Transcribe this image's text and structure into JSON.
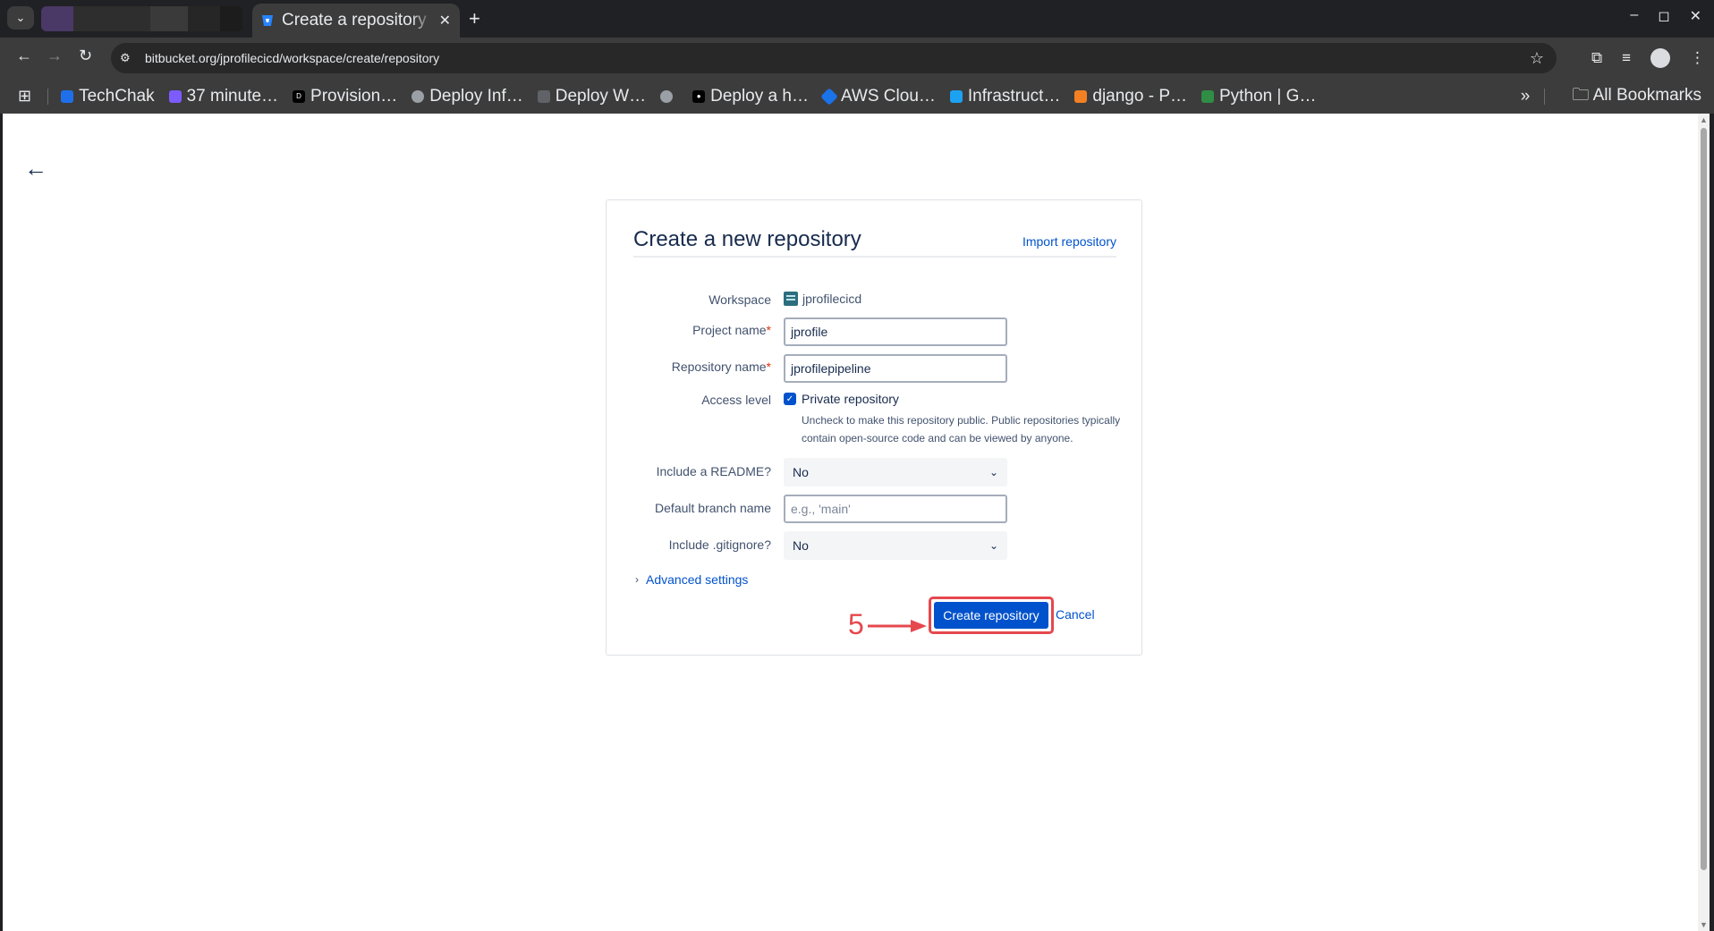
{
  "browser": {
    "tab_title": "Create a repository",
    "tab_close": "✕",
    "new_tab": "+",
    "url": "bitbucket.org/jprofilecicd/workspace/create/repository",
    "bookmarks": [
      {
        "label": "TechChak",
        "icon": "techchak-icon",
        "color": "#1f6feb"
      },
      {
        "label": "37 minute…",
        "icon": "dollar-icon",
        "color": "#7c5cff"
      },
      {
        "label": "Provision…",
        "icon": "dev-icon",
        "color": "#000000"
      },
      {
        "label": "Deploy Inf…",
        "icon": "globe-icon",
        "color": "#9aa0a6"
      },
      {
        "label": "Deploy W…",
        "icon": "mortarboard-icon",
        "color": "#202124"
      },
      {
        "label": "",
        "icon": "globe-icon",
        "color": "#9aa0a6"
      },
      {
        "label": "Deploy a h…",
        "icon": "medium-icon",
        "color": "#000000"
      },
      {
        "label": "AWS Clou…",
        "icon": "aws-icon",
        "color": "#1a73e8"
      },
      {
        "label": "Infrastruct…",
        "icon": "chart-icon",
        "color": "#1da1f2"
      },
      {
        "label": "django - P…",
        "icon": "stack-icon",
        "color": "#f48024"
      },
      {
        "label": "Python | G…",
        "icon": "gfg-icon",
        "color": "#2f8d46"
      }
    ],
    "overflow": "»",
    "all_bookmarks": "All Bookmarks"
  },
  "page": {
    "title": "Create a new repository",
    "import_link": "Import repository",
    "workspace_label": "Workspace",
    "workspace_value": "jprofilecicd",
    "project_label": "Project name",
    "project_value": "jprofile",
    "repo_label": "Repository name",
    "repo_value": "jprofilepipeline",
    "required_mark": "*",
    "access_label": "Access level",
    "private_label": "Private repository",
    "private_checked": true,
    "private_help": "Uncheck to make this repository public. Public repositories typically contain open-source code and can be viewed by anyone.",
    "readme_label": "Include a README?",
    "readme_value": "No",
    "branch_label": "Default branch name",
    "branch_placeholder": "e.g., 'main'",
    "gitignore_label": "Include .gitignore?",
    "gitignore_value": "No",
    "advanced_label": "Advanced settings",
    "create_button": "Create repository",
    "cancel_link": "Cancel",
    "step_number": "5"
  },
  "colors": {
    "primary": "#0052cc",
    "annotation": "#e5484d",
    "text": "#172b4d"
  }
}
